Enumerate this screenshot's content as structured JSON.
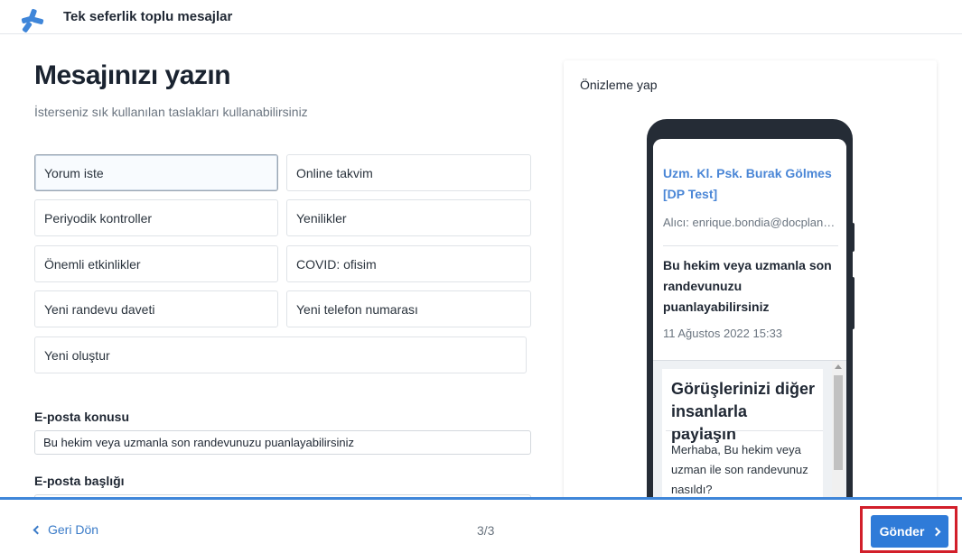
{
  "header": {
    "title": "Tek seferlik toplu mesajlar",
    "logo_icon": "plus-asterisk-logo",
    "logo_color": "#3f86d9"
  },
  "main": {
    "title": "Mesajınızı yazın",
    "subtitle": "İsterseniz sık kullanılan taslakları kullanabilirsiniz",
    "templates": [
      {
        "label": "Yorum iste",
        "selected": true
      },
      {
        "label": "Online takvim"
      },
      {
        "label": "Periyodik kontroller"
      },
      {
        "label": "Yenilikler"
      },
      {
        "label": "Önemli etkinlikler"
      },
      {
        "label": "COVID: ofisim"
      },
      {
        "label": "Yeni randevu daveti"
      },
      {
        "label": "Yeni telefon numarası"
      },
      {
        "label": "Yeni oluştur"
      }
    ],
    "subject": {
      "label": "E-posta konusu",
      "value": "Bu hekim veya uzmanla son randevunuzu puanlayabilirsiniz"
    },
    "heading": {
      "label": "E-posta başlığı",
      "value": ""
    }
  },
  "preview": {
    "title": "Önizleme yap",
    "sender": "Uzm. Kl. Psk. Burak Gölmes [DP Test]",
    "recipient": "Alıcı: enrique.bondia@docplanner.com",
    "subject": "Bu hekim veya uzmanla son randevunuzu puanlayabilirsiniz",
    "date": "11 Ağustos 2022 15:33",
    "body_heading": "Görüşlerinizi diğer insanlarla paylaşın",
    "body_text": "Merhaba, Bu hekim veya uzman ile son randevunuz nasıldı?"
  },
  "footer": {
    "back_label": "Geri Dön",
    "pager": "3/3",
    "send_label": "Gönder",
    "accent": "#2f7bd8",
    "highlight_color": "#d21f2a"
  }
}
